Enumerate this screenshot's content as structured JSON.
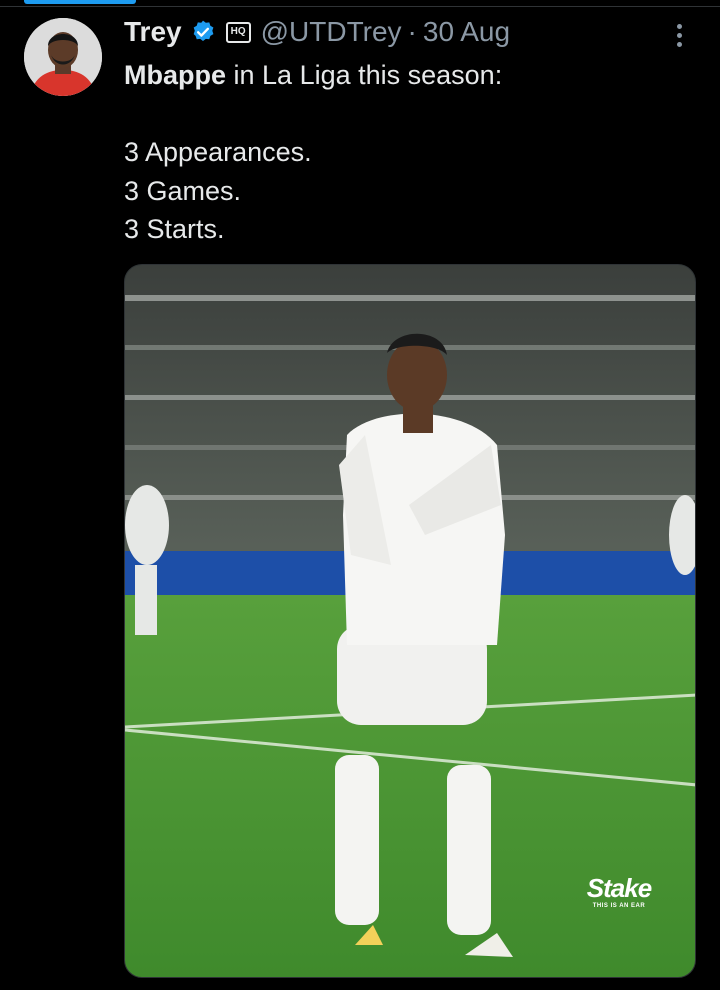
{
  "author": {
    "display_name": "Trey",
    "handle": "@UTDTrey",
    "separator": "·",
    "timestamp": "30 Aug",
    "verified": true,
    "affiliate_badge_text": "HQ"
  },
  "tweet": {
    "line1_bold": "Mbappe",
    "line1_rest": " in La Liga this season:",
    "stats": [
      "3 Appearances.",
      "3 Games.",
      "3 Starts."
    ]
  },
  "media": {
    "sponsor_brand": "Stake",
    "sponsor_tagline": "THIS IS AN EAR"
  },
  "colors": {
    "background": "#000000",
    "text_primary": "#e7e9ea",
    "text_secondary": "#8b98a5",
    "accent": "#1d9bf0"
  },
  "icons": {
    "verified": "verified-badge-icon",
    "more": "more-options-icon"
  }
}
